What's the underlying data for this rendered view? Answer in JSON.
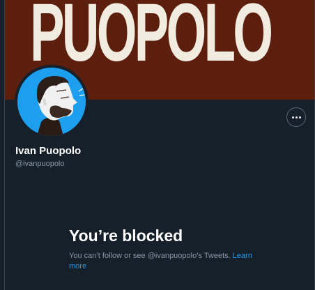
{
  "banner": {
    "text": "PUOPOLO",
    "background_color": "#5c1f0d",
    "text_color": "#f2ece0"
  },
  "profile": {
    "display_name": "Ivan Puopolo",
    "handle": "@ivanpuopolo",
    "avatar_icon": "profile-portrait",
    "avatar_bg_color": "#1d9ff0"
  },
  "actions": {
    "more_icon": "more-horizontal-icon"
  },
  "blocked": {
    "title": "You’re blocked",
    "message": "You can’t follow or see @ivanpuopolo’s Tweets.",
    "link_label": "Learn more",
    "link_color": "#1d9bf0"
  }
}
